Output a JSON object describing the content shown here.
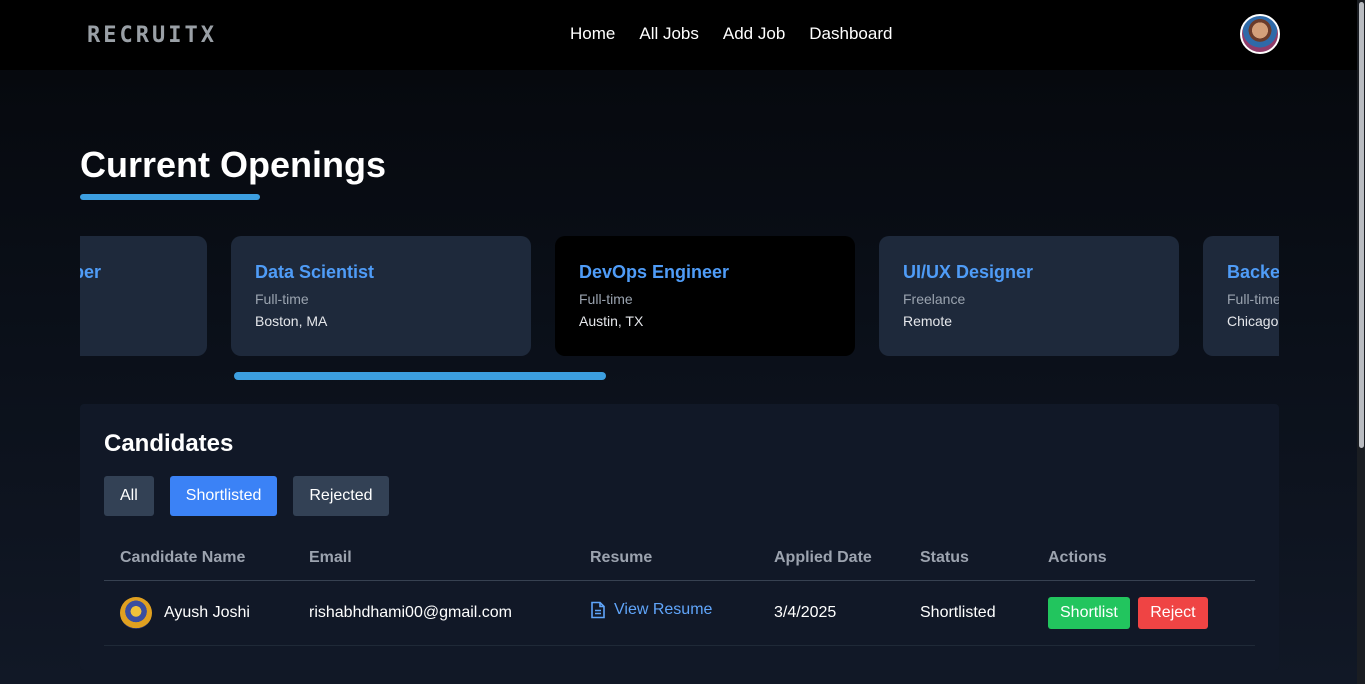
{
  "brand": {
    "logo": "RECRUITX"
  },
  "nav": {
    "items": [
      "Home",
      "All Jobs",
      "Add Job",
      "Dashboard"
    ]
  },
  "page": {
    "title": "Current Openings"
  },
  "jobs": [
    {
      "title": "Frontend Developer",
      "type": "",
      "location": ""
    },
    {
      "title": "Data Scientist",
      "type": "Full-time",
      "location": "Boston, MA"
    },
    {
      "title": "DevOps Engineer",
      "type": "Full-time",
      "location": "Austin, TX",
      "active": true
    },
    {
      "title": "UI/UX Designer",
      "type": "Freelance",
      "location": "Remote"
    },
    {
      "title": "Backend Developer",
      "type": "Full-time",
      "location": "Chicago, IL"
    }
  ],
  "carousel": {
    "progress_fraction": 1.0
  },
  "candidates": {
    "title": "Candidates",
    "filters": [
      "All",
      "Shortlisted",
      "Rejected"
    ],
    "selected_filter": "Shortlisted",
    "columns": [
      "Candidate Name",
      "Email",
      "Resume",
      "Applied Date",
      "Status",
      "Actions"
    ],
    "rows": [
      {
        "name": "Ayush Joshi",
        "email": "rishabhdhami00@gmail.com",
        "resume": "View Resume",
        "applied": "3/4/2025",
        "status": "Shortlisted",
        "actions": [
          "Shortlist",
          "Reject"
        ]
      }
    ]
  },
  "colors": {
    "accent": "#3c9fe0",
    "link": "#4f9cf7",
    "success": "#22c55e",
    "danger": "#ef4444",
    "selected_filter": "#3b82f6"
  },
  "icons": {
    "resume": "document-icon"
  }
}
